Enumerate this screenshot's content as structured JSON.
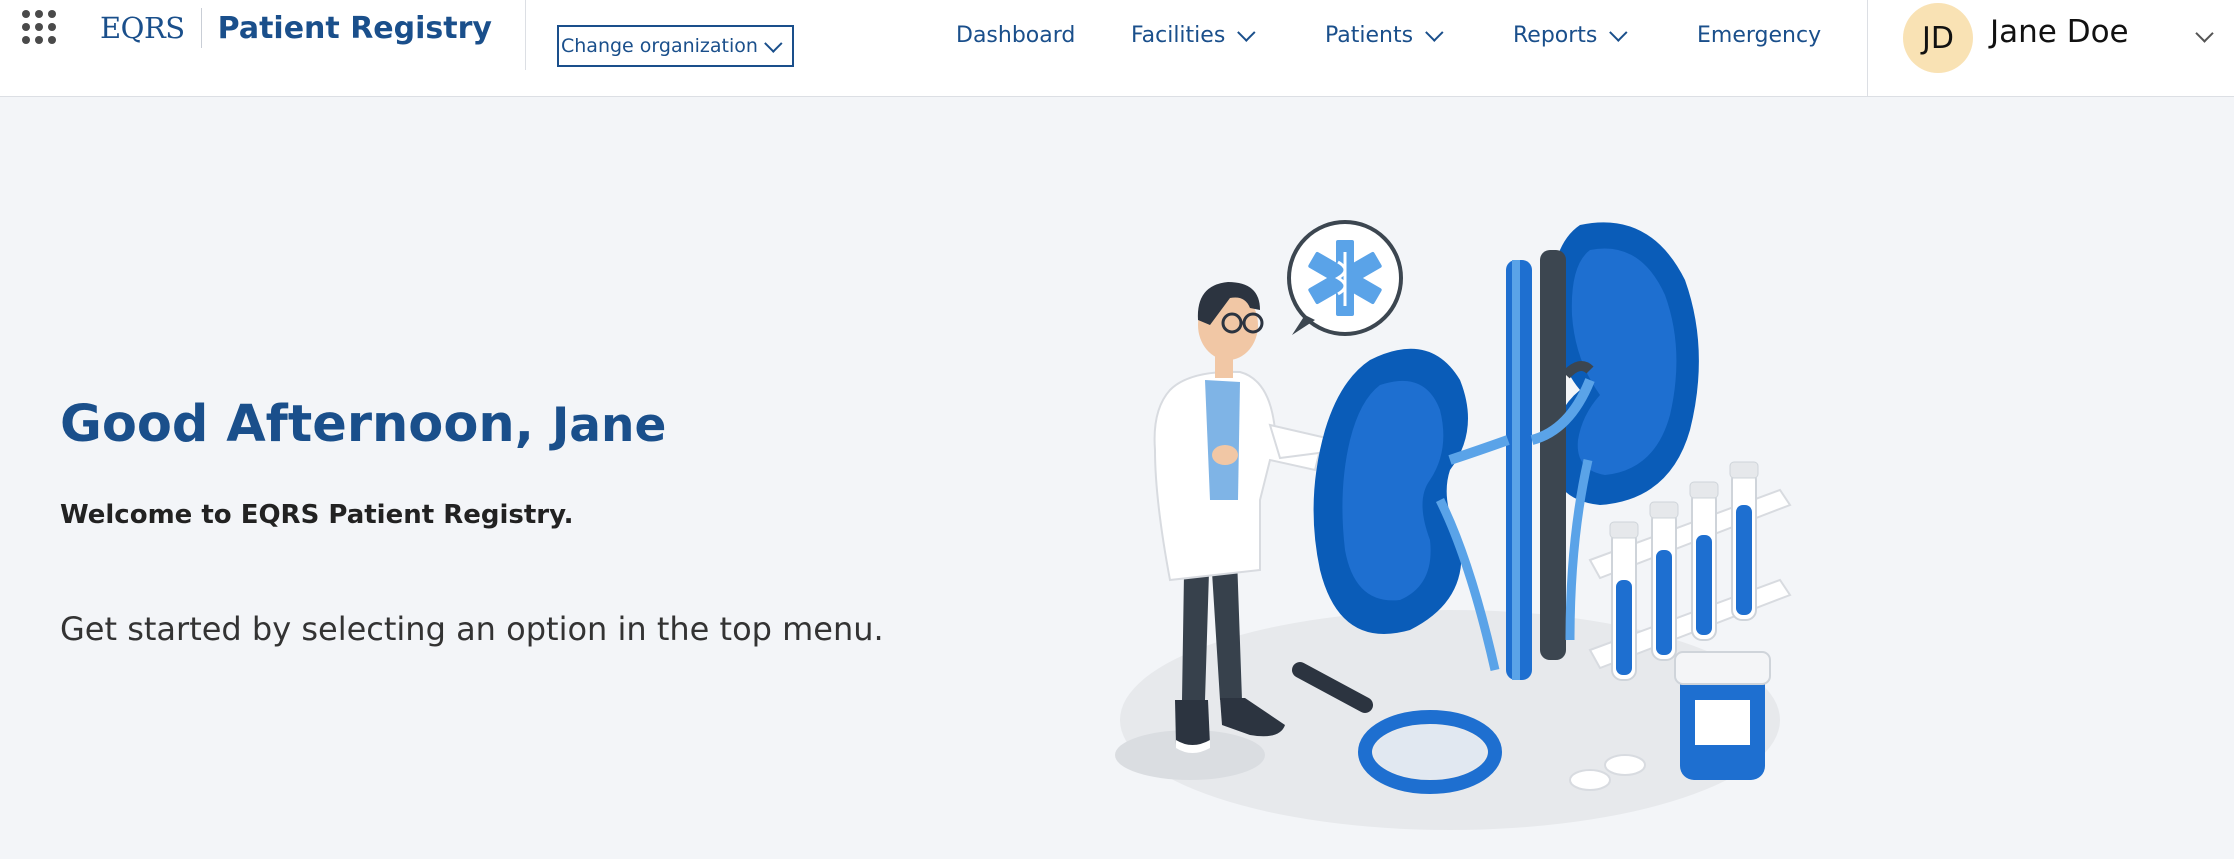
{
  "header": {
    "brand_short": "EQRS",
    "brand_app": "Patient Registry",
    "org_button": "Change organization",
    "nav": [
      {
        "label": "Dashboard",
        "has_dropdown": false
      },
      {
        "label": "Facilities",
        "has_dropdown": true
      },
      {
        "label": "Patients",
        "has_dropdown": true
      },
      {
        "label": "Reports",
        "has_dropdown": true
      },
      {
        "label": "Emergency",
        "has_dropdown": false
      }
    ],
    "user": {
      "initials": "JD",
      "name": "Jane Doe"
    }
  },
  "main": {
    "greeting": "Good Afternoon,",
    "greeting_name": "Jane",
    "welcome": "Welcome to EQRS Patient Registry.",
    "instructions": "Get started by selecting an option in the top menu."
  },
  "colors": {
    "brand": "#1a4f8b",
    "background": "#f3f5f8",
    "avatar_bg": "#f9e2b4",
    "illustration_blue": "#0a5cb8"
  },
  "icons": {
    "app_launcher": "grid-dots-icon",
    "dropdown": "chevron-down-icon",
    "illustration_badge": "star-of-life-icon"
  }
}
